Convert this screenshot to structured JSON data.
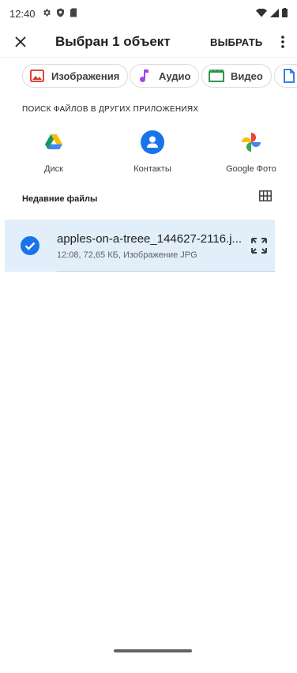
{
  "status_bar": {
    "time": "12:40"
  },
  "toolbar": {
    "title": "Выбран 1 объект",
    "select_label": "ВЫБРАТЬ"
  },
  "chips": [
    {
      "label": "Изображения",
      "icon": "image-icon",
      "color": "#d93025"
    },
    {
      "label": "Аудио",
      "icon": "music-note-icon",
      "color": "#a142f4"
    },
    {
      "label": "Видео",
      "icon": "video-icon",
      "color": "#1e8e3e"
    },
    {
      "label": "",
      "icon": "document-icon",
      "color": "#1a73e8"
    }
  ],
  "other_apps": {
    "title": "ПОИСК ФАЙЛОВ В ДРУГИХ ПРИЛОЖЕНИЯХ",
    "items": [
      {
        "label": "Диск",
        "icon": "google-drive-icon"
      },
      {
        "label": "Контакты",
        "icon": "contacts-icon",
        "color": "#1a73e8"
      },
      {
        "label": "Google Фото",
        "icon": "google-photos-icon"
      }
    ]
  },
  "recent": {
    "title": "Недавние файлы",
    "files": [
      {
        "name": "apples-on-a-treee_144627-2116.j...",
        "meta": "12:08, 72,65 КБ, Изображение JPG",
        "selected": true
      }
    ]
  },
  "colors": {
    "accent": "#1a73e8",
    "selected_row_bg": "#e3eefb"
  }
}
